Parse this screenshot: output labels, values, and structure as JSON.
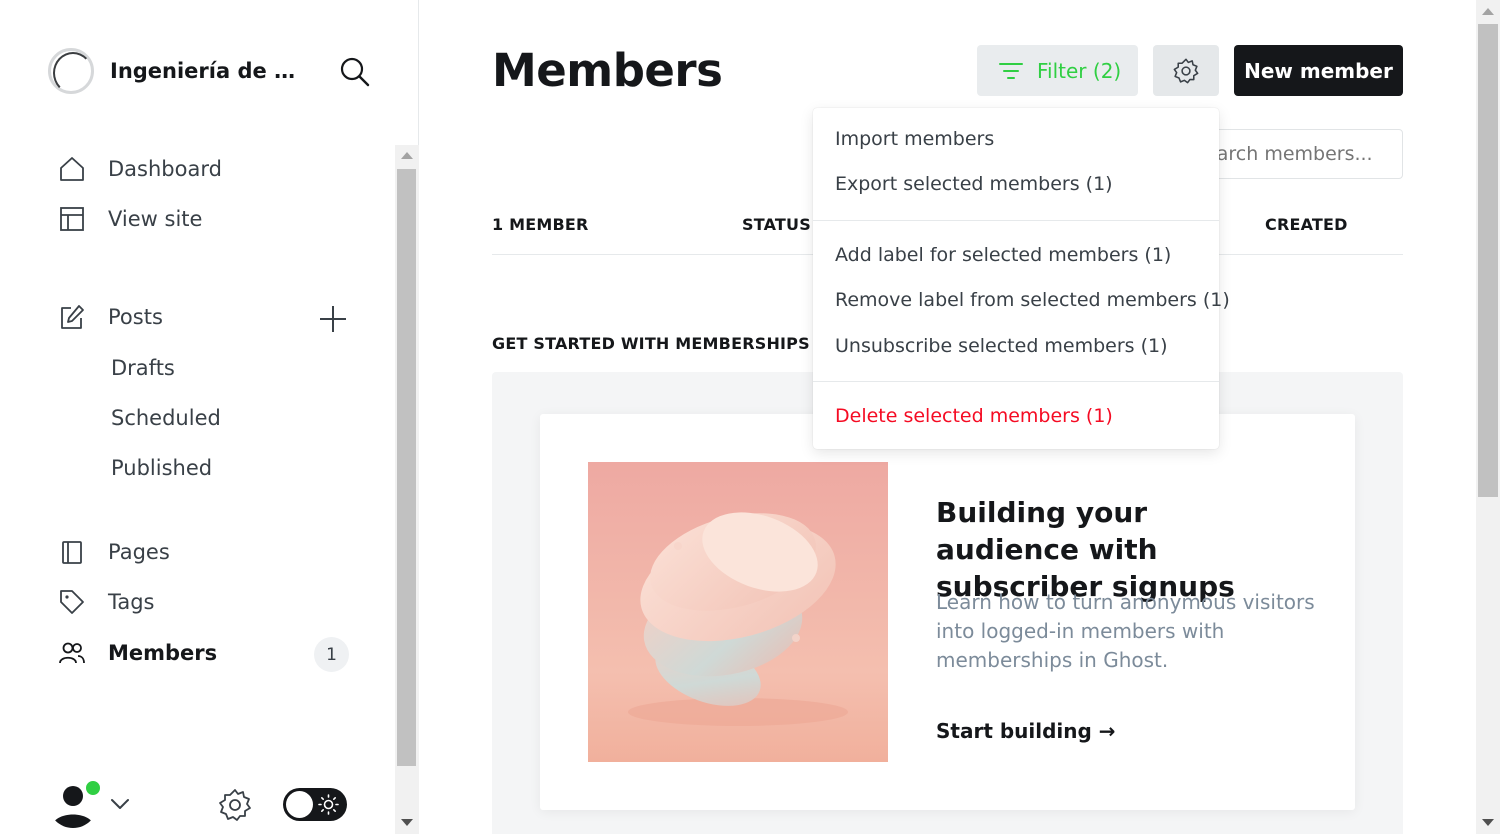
{
  "sidebar": {
    "site_title": "Ingeniería de So...",
    "search_icon": "search-icon",
    "nav": {
      "dashboard": "Dashboard",
      "view_site": "View site",
      "posts": "Posts",
      "drafts": "Drafts",
      "scheduled": "Scheduled",
      "published": "Published",
      "pages": "Pages",
      "tags": "Tags",
      "members": "Members",
      "members_count": "1"
    },
    "user_status_color": "#30cf43"
  },
  "header": {
    "title": "Members",
    "filter_label": "Filter (2)",
    "filter_color": "#30cf43",
    "new_member_label": "New member"
  },
  "search": {
    "placeholder": "Search members..."
  },
  "table": {
    "columns": [
      "1 MEMBER",
      "STATUS",
      "CREATED"
    ]
  },
  "get_started": {
    "heading": "GET STARTED WITH MEMBERSHIPS",
    "card_title": "Building your audience with subscriber signups",
    "card_desc": "Learn how to turn anonymous visitors into logged-in members with memberships in Ghost.",
    "card_link": "Start building →"
  },
  "dropdown": {
    "import": "Import members",
    "export": "Export selected members (1)",
    "add_label": "Add label for selected members (1)",
    "remove_label": "Remove label from selected members (1)",
    "unsubscribe": "Unsubscribe selected members (1)",
    "delete": "Delete selected members (1)",
    "danger_color": "#f50b23"
  }
}
